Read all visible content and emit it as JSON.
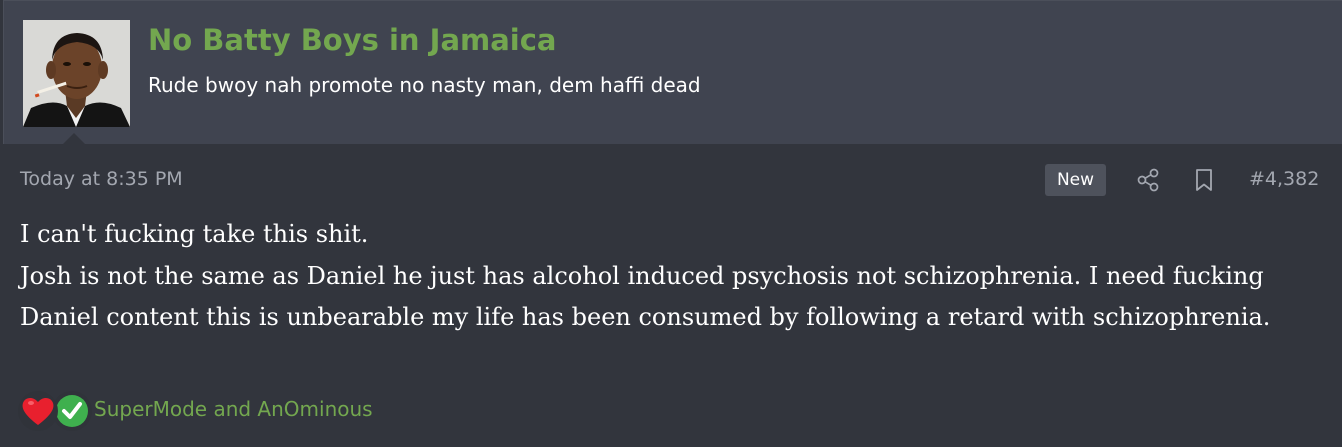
{
  "user": {
    "name": "No Batty Boys in Jamaica",
    "title": "Rude bwoy nah promote no nasty man, dem haffi dead"
  },
  "post": {
    "date": "Today at 8:35 PM",
    "badge": "New",
    "number": "#4,382",
    "paragraphs": [
      "I can't fucking take this shit.",
      "Josh is not the same as Daniel he just has alcohol induced psychosis not schizophrenia. I need fucking Daniel content this is unbearable my life has been consumed by following a retard with schizophrenia."
    ]
  },
  "reactions": {
    "icons": [
      "heart-icon",
      "check-icon"
    ],
    "names": "SuperMode and AnOminous"
  },
  "colors": {
    "background": "#32353d",
    "header": "#404450",
    "username": "#73a74f",
    "meta": "#a3a7b0"
  }
}
